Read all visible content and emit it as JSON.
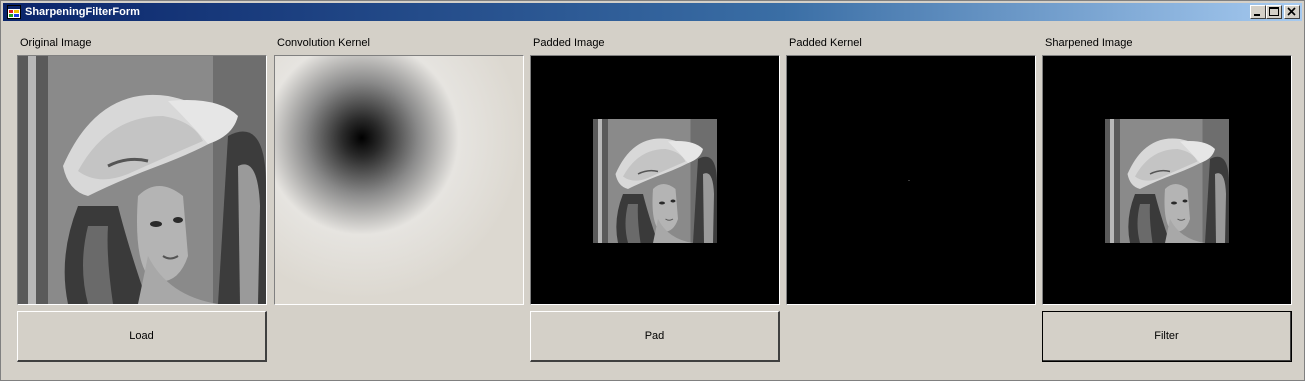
{
  "window": {
    "title": "SharpeningFilterForm"
  },
  "panels": [
    {
      "label": "Original Image"
    },
    {
      "label": "Convolution Kernel"
    },
    {
      "label": "Padded Image"
    },
    {
      "label": "Padded Kernel"
    },
    {
      "label": "Sharpened Image"
    }
  ],
  "buttons": {
    "load": "Load",
    "pad": "Pad",
    "filter": "Filter"
  },
  "icons": {
    "app": "app-form-icon",
    "minimize": "minimize-icon",
    "maximize": "maximize-icon",
    "close": "close-icon"
  },
  "colors": {
    "face": "#d4d0c8",
    "title_start": "#0a246a",
    "title_end": "#a6caf0"
  }
}
